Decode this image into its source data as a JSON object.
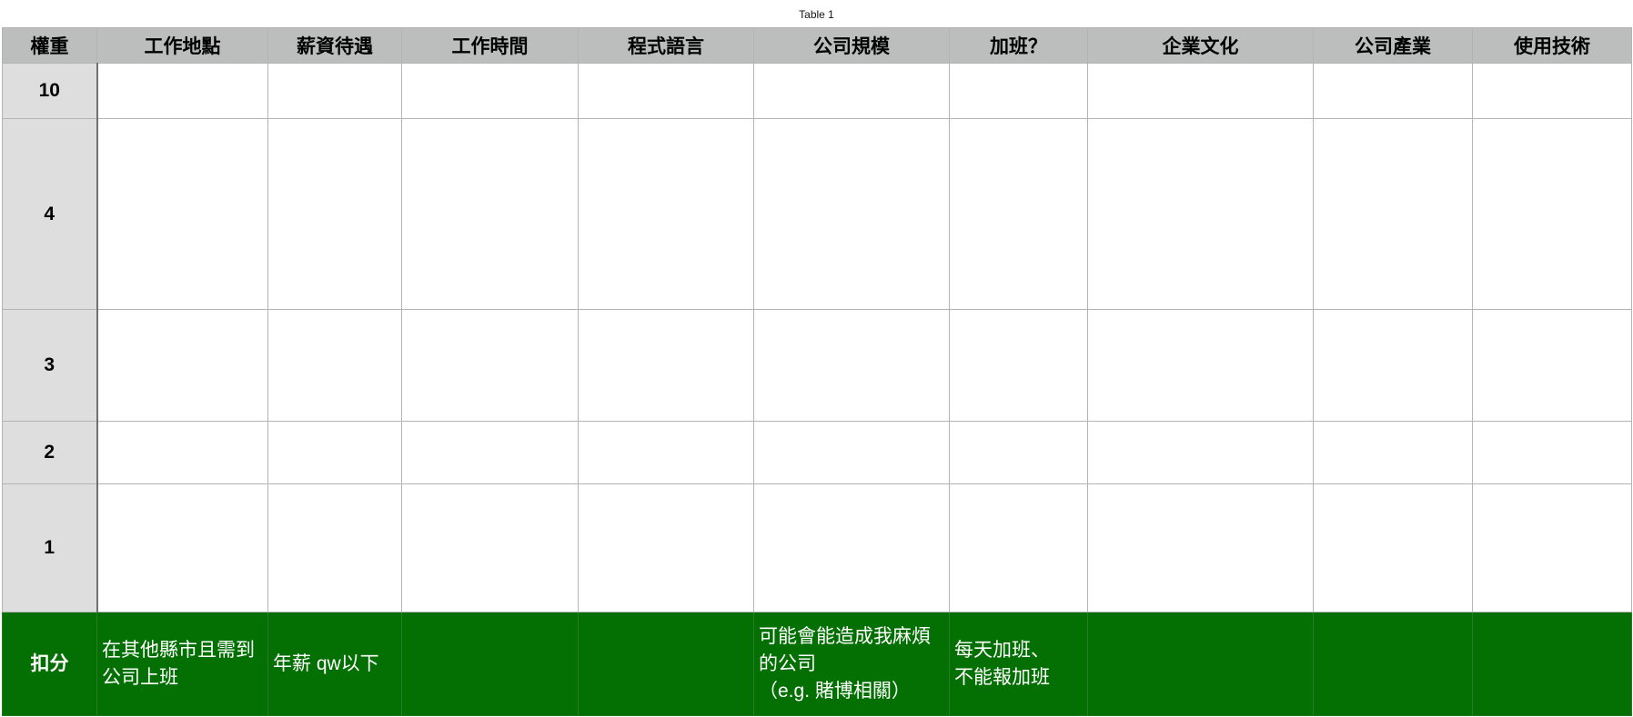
{
  "table": {
    "title": "Table 1",
    "headers": [
      "權重",
      "工作地點",
      "薪資待遇",
      "工作時間",
      "程式語言",
      "公司規模",
      "加班？",
      "企業文化",
      "公司產業",
      "使用技術"
    ],
    "weights": [
      "10",
      "4",
      "3",
      "2",
      "1"
    ],
    "deduct_row": {
      "label": "扣分",
      "cells": [
        "在其他縣市且需到公司上班",
        "年薪 qw以下",
        "",
        "",
        "可能會能造成我麻煩的公司\n（e.g. 賭博相關）",
        "每天加班、\n不能報加班",
        "",
        "",
        ""
      ]
    }
  },
  "colors": {
    "header_background": "#bcbebd",
    "weight_column_background": "#dedede",
    "deduct_row_background": "#047003",
    "grid_line": "#b4b4b4"
  }
}
